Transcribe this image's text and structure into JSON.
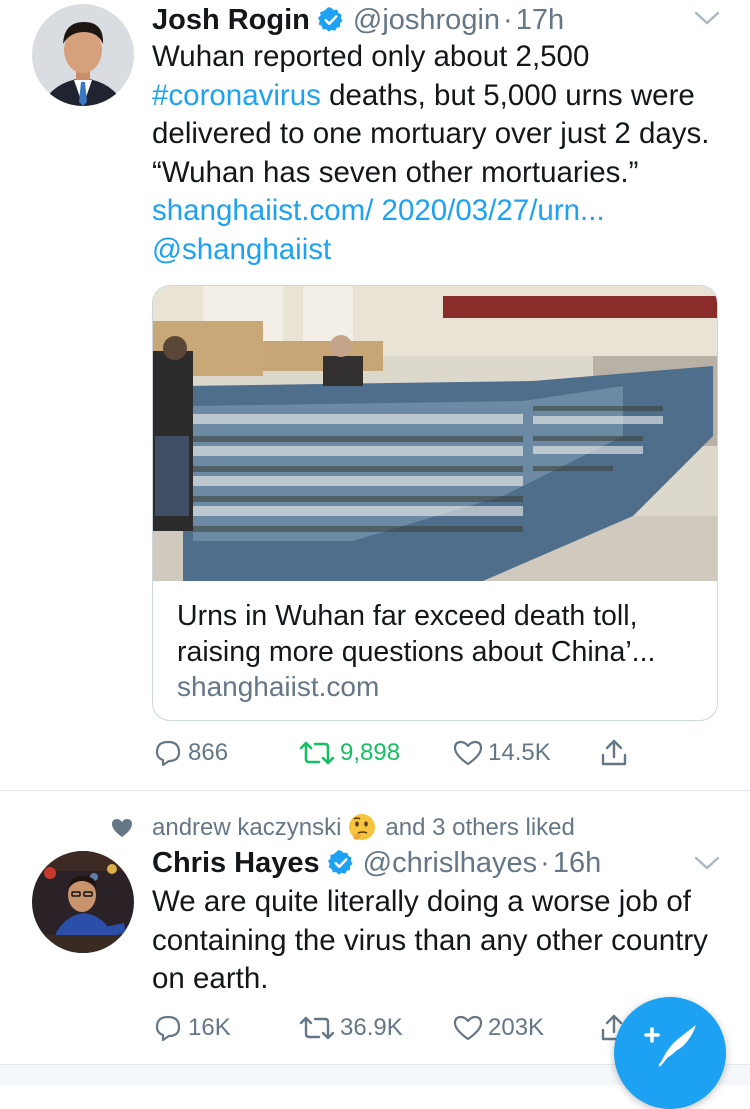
{
  "colors": {
    "link": "#1da1f2",
    "retweeted": "#17bf63",
    "muted": "#657786",
    "text": "#14171a",
    "fab": "#1da1f2"
  },
  "tweets": [
    {
      "name": "Josh Rogin",
      "verified": true,
      "handle": "@joshrogin",
      "separator": "·",
      "time": "17h",
      "text_1": "Wuhan reported only about 2,500",
      "hashtag": "#coronavirus",
      "text_2": " deaths, but 5,000 urns were delivered to one mortuary over just 2 days. “Wuhan has seven other mortuaries.” ",
      "url": "shanghaiist.com/ 2020/03/27/urn...",
      "mention": "@shanghaiist",
      "card": {
        "title": "Urns in Wuhan far exceed death toll, raising more questions about China’...",
        "domain": "shanghaiist.com",
        "image_alt": "stacked urn boxes in a hall"
      },
      "replies": "866",
      "retweets": "9,898",
      "likes": "14.5K",
      "retweeted": true
    },
    {
      "social_context": {
        "icon": "heart-icon",
        "user": "andrew kaczynski",
        "emoji": "thinking-face-emoji",
        "suffix": "and 3 others liked"
      },
      "name": "Chris Hayes",
      "verified": true,
      "handle": "@chrislhayes",
      "separator": "·",
      "time": "16h",
      "text": "We are quite literally doing a worse job of containing the virus than any other country on earth.",
      "replies": "16K",
      "retweets": "36.9K",
      "likes": "203K"
    }
  ],
  "compose": {
    "icon": "compose-tweet-icon"
  }
}
